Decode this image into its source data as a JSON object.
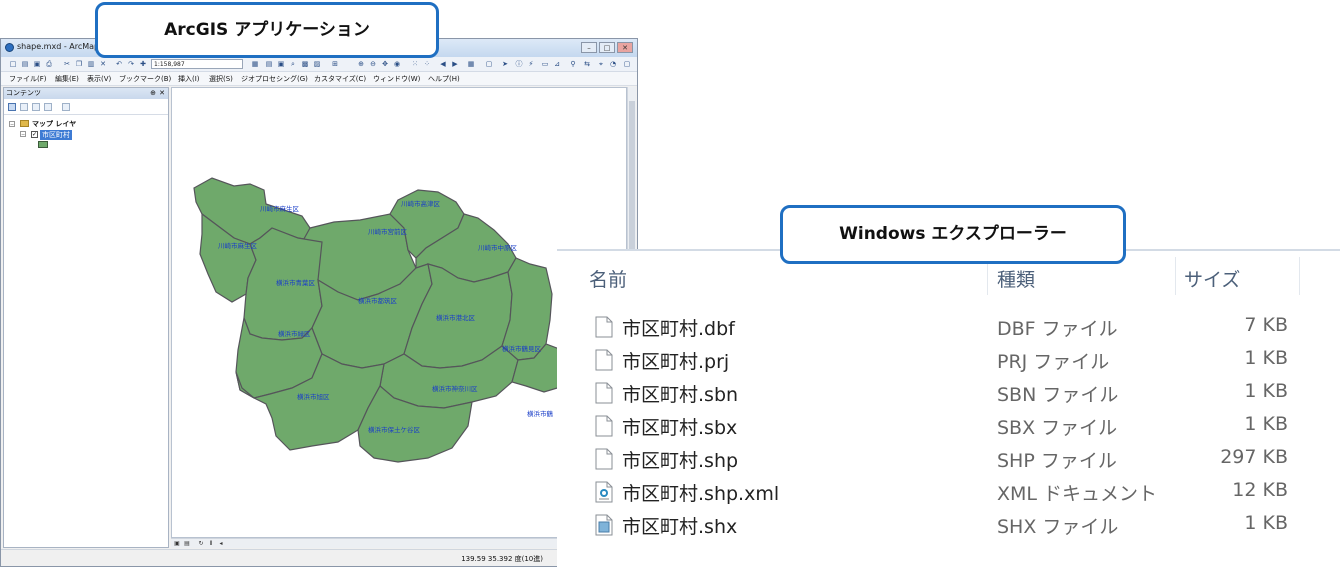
{
  "arcmap": {
    "title": "shape.mxd - ArcMap",
    "win_buttons": [
      "–",
      "□",
      "✕"
    ],
    "scale": "1:158,987",
    "menus": [
      "ファイル(F)",
      "編集(E)",
      "表示(V)",
      "ブックマーク(B)",
      "挿入(I)",
      "選択(S)",
      "ジオプロセシング(G)",
      "カスタマイズ(C)",
      "ウィンドウ(W)",
      "ヘルプ(H)"
    ],
    "toc": {
      "title": "コンテンツ",
      "pin": "⊕",
      "close": "✕",
      "root_layer": "マップ レイヤ",
      "layer": "市区町村"
    },
    "map_labels": [
      "川崎市麻生区",
      "川崎市高津区",
      "川崎市宮前区",
      "川崎市中原区",
      "川崎市麻生区",
      "横浜市青葉区",
      "横浜市都筑区",
      "横浜市港北区",
      "横浜市緑区",
      "横浜市鶴見区",
      "横浜市神奈川区",
      "横浜市旭区",
      "横浜市保土ケ谷区",
      "横浜市鶴"
    ],
    "status_coords": "139.59  35.392 度(10進)",
    "layer_fill": "#6fa96b"
  },
  "callouts": {
    "arcgis": "ArcGIS アプリケーション",
    "explorer": "Windows エクスプローラー"
  },
  "explorer": {
    "headers": {
      "name": "名前",
      "type": "種類",
      "size": "サイズ"
    },
    "files": [
      {
        "name": "市区町村.dbf",
        "type": "DBF ファイル",
        "size": "7 KB",
        "icon": "blank-file-icon"
      },
      {
        "name": "市区町村.prj",
        "type": "PRJ ファイル",
        "size": "1 KB",
        "icon": "blank-file-icon"
      },
      {
        "name": "市区町村.sbn",
        "type": "SBN ファイル",
        "size": "1 KB",
        "icon": "blank-file-icon"
      },
      {
        "name": "市区町村.sbx",
        "type": "SBX ファイル",
        "size": "1 KB",
        "icon": "blank-file-icon"
      },
      {
        "name": "市区町村.shp",
        "type": "SHP ファイル",
        "size": "297 KB",
        "icon": "blank-file-icon"
      },
      {
        "name": "市区町村.shp.xml",
        "type": "XML ドキュメント",
        "size": "12 KB",
        "icon": "xml-file-icon"
      },
      {
        "name": "市区町村.shx",
        "type": "SHX ファイル",
        "size": "1 KB",
        "icon": "shx-file-icon"
      }
    ]
  }
}
